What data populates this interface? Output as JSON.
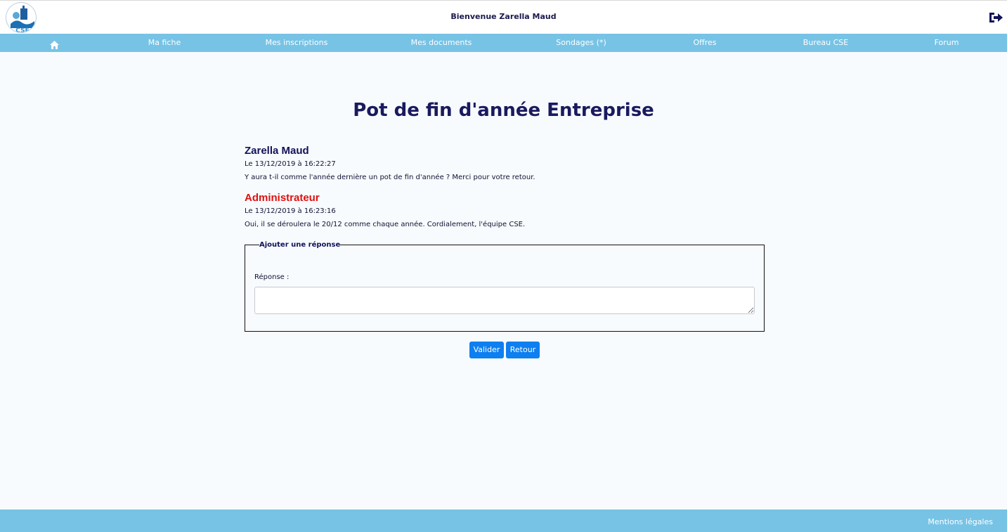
{
  "header": {
    "logo_icon": "cse-logo-icon",
    "welcome": "Bienvenue Zarella Maud",
    "logout_icon": "sign-out-icon"
  },
  "nav": {
    "home_icon": "home-icon",
    "items": [
      "Ma fiche",
      "Mes inscriptions",
      "Mes documents",
      "Sondages (*)",
      "Offres",
      "Bureau CSE",
      "Forum"
    ]
  },
  "thread": {
    "title": "Pot de fin d'année Entreprise",
    "posts": [
      {
        "author": "Zarella Maud",
        "date": "Le 13/12/2019 à 16:22:27",
        "message": "Y aura t-il comme l'année dernière un pot de fin d'année ? Merci pour votre retour."
      },
      {
        "author": "Administrateur",
        "date": "Le 13/12/2019 à 16:23:16",
        "message": "Oui, il se déroulera le 20/12 comme chaque année. Cordialement, l'équipe CSE."
      }
    ]
  },
  "reply": {
    "legend": "Ajouter une réponse",
    "label": "Réponse :",
    "value": "",
    "submit": "Valider",
    "back": "Retour"
  },
  "footer": {
    "legal": "Mentions légales"
  },
  "colors": {
    "nav_bg": "#77c3e5",
    "button": "#0d7ff0",
    "admin_author": "#e01010",
    "title": "#1a1a5e"
  }
}
